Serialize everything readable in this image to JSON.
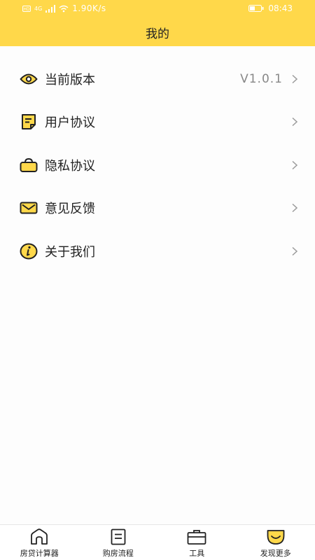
{
  "status_bar": {
    "signal_text": "4G",
    "net_speed": "1.90K/s",
    "time": "08:43"
  },
  "header": {
    "title": "我的"
  },
  "menu": {
    "items": [
      {
        "icon": "eye-icon",
        "label": "当前版本",
        "value": "V1.0.1"
      },
      {
        "icon": "document-icon",
        "label": "用户协议"
      },
      {
        "icon": "bag-icon",
        "label": "隐私协议"
      },
      {
        "icon": "mail-icon",
        "label": "意见反馈"
      },
      {
        "icon": "info-icon",
        "label": "关于我们"
      }
    ]
  },
  "bottom_nav": {
    "items": [
      {
        "icon": "home-icon",
        "label": "房贷计算器"
      },
      {
        "icon": "list-icon",
        "label": "购房流程"
      },
      {
        "icon": "toolbox-icon",
        "label": "工具"
      },
      {
        "icon": "smile-icon",
        "label": "发现更多",
        "active": true
      }
    ]
  },
  "colors": {
    "accent": "#ffd84a",
    "stroke": "#222222",
    "muted": "#888888"
  }
}
